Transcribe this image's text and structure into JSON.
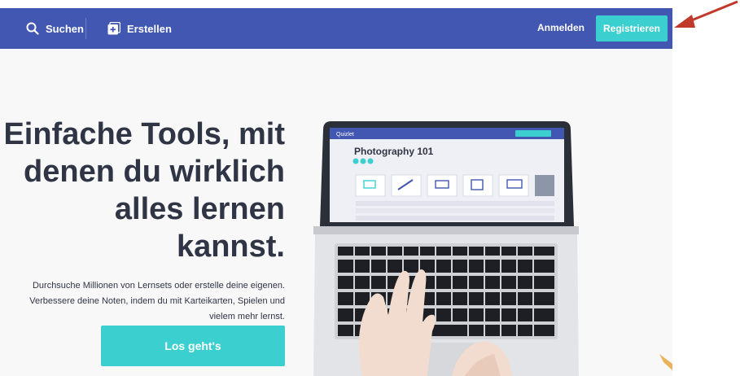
{
  "header": {
    "search_label": "Suchen",
    "create_label": "Erstellen",
    "login_label": "Anmelden",
    "register_label": "Registrieren"
  },
  "hero": {
    "headline_line1": "Einfache Tools, mit",
    "headline_line2": "denen du wirklich",
    "headline_line3": "alles lernen",
    "headline_line4": "kannst.",
    "sub_line1": "Durchsuche Millionen von Lernsets oder erstelle deine eigenen.",
    "sub_line2": "Verbessere deine Noten, indem du mit Karteikarten, Spielen und",
    "sub_line3": "vielem mehr lernst.",
    "cta_label": "Los geht's"
  },
  "laptop_screen": {
    "app_name": "Quizlet",
    "set_title": "Photography 101"
  },
  "colors": {
    "topbar": "#4257b2",
    "accent": "#3ccfcf",
    "text": "#303545",
    "annotation_arrow": "#c0392b"
  },
  "icons": {
    "search": "search-icon",
    "create": "plus-square-icon",
    "arrow": "annotation-arrow-icon"
  }
}
